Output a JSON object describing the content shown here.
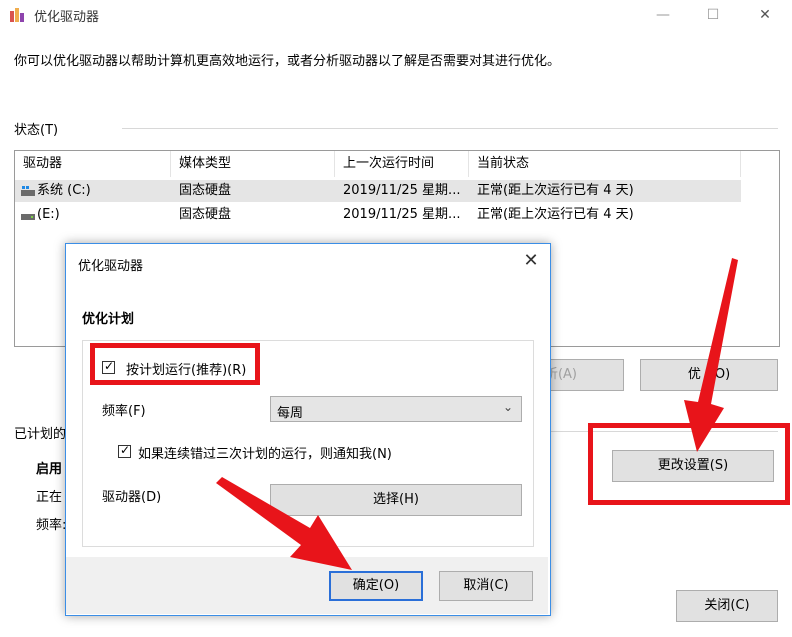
{
  "window": {
    "title": "优化驱动器",
    "description": "你可以优化驱动器以帮助计算机更高效地运行，或者分析驱动器以了解是否需要对其进行优化。",
    "status_label": "状态(T)"
  },
  "table": {
    "headers": [
      "驱动器",
      "媒体类型",
      "上一次运行时间",
      "当前状态"
    ],
    "rows": [
      {
        "drive": "系统 (C:)",
        "media": "固态硬盘",
        "last_run": "2019/11/25 星期...",
        "status": "正常(距上次运行已有 4 天)"
      },
      {
        "drive": "(E:)",
        "media": "固态硬盘",
        "last_run": "2019/11/25 星期...",
        "status": "正常(距上次运行已有 4 天)"
      }
    ]
  },
  "buttons": {
    "analyze_partial": "析(A)",
    "optimize_left": "优",
    "optimize_right": "O)",
    "change_settings": "更改设置(S)",
    "close": "关闭(C)"
  },
  "schedule": {
    "label": "已计划的",
    "line1": "启用",
    "line2": "正在",
    "line3": "频率:"
  },
  "dialog": {
    "title": "优化驱动器",
    "section": "优化计划",
    "run_on_schedule": "按计划运行(推荐)(R)",
    "frequency_label": "频率(F)",
    "frequency_value": "每周",
    "notify_label": "如果连续错过三次计划的运行，则通知我(N)",
    "drives_label": "驱动器(D)",
    "choose_button": "选择(H)",
    "ok_button": "确定(O)",
    "cancel_button": "取消(C)"
  },
  "colors": {
    "annotation_red": "#e8141a",
    "dialog_border": "#3b8ee6"
  }
}
